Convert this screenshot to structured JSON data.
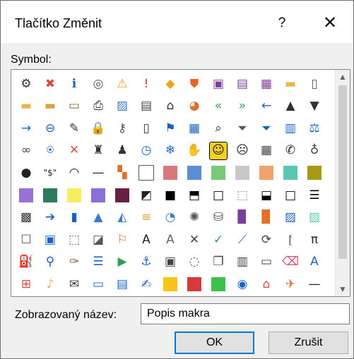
{
  "dialog": {
    "title": "Tlačítko Změnit",
    "help_glyph": "?",
    "close_glyph": "✕",
    "symbol_label": "Symbol:",
    "display_name_label": "Zobrazovaný název:",
    "display_name_value": "Popis makra",
    "ok_label": "OK",
    "cancel_label": "Zrušit",
    "scroll_up_glyph": "▲",
    "scroll_down_glyph": "▼"
  },
  "symbols": [
    {
      "name": "org-chart-icon",
      "glyph": "⚙",
      "color": "#333"
    },
    {
      "name": "error-icon",
      "glyph": "✖",
      "color": "#e04a3c"
    },
    {
      "name": "info-icon",
      "glyph": "ℹ",
      "color": "#1a62c4"
    },
    {
      "name": "record-icon",
      "glyph": "◎",
      "color": "#555"
    },
    {
      "name": "warning-icon",
      "glyph": "⚠",
      "color": "#f0a51c"
    },
    {
      "name": "exclamation-icon",
      "glyph": "!",
      "color": "#e0312c"
    },
    {
      "name": "diamond-warning-icon",
      "glyph": "◆",
      "color": "#f0a51c"
    },
    {
      "name": "shield-icon",
      "glyph": "⛊",
      "color": "#e8641e"
    },
    {
      "name": "save-icon",
      "glyph": "▣",
      "color": "#7a3e9b"
    },
    {
      "name": "save-as-icon",
      "glyph": "▤",
      "color": "#7a3e9b"
    },
    {
      "name": "save-all-icon",
      "glyph": "▦",
      "color": "#7a3e9b"
    },
    {
      "name": "folder-icon",
      "glyph": "▬",
      "color": "#e8b84a"
    },
    {
      "name": "new-document-icon",
      "glyph": "▯",
      "color": "#555"
    },
    {
      "name": "folder-open-icon",
      "glyph": "▬",
      "color": "#e8b84a"
    },
    {
      "name": "folder-up-icon",
      "glyph": "▬",
      "color": "#d9a23a"
    },
    {
      "name": "move-folder-icon",
      "glyph": "▭",
      "color": "#8a6a3a"
    },
    {
      "name": "printer-icon",
      "glyph": "⎙",
      "color": "#333"
    },
    {
      "name": "picture-icon",
      "glyph": "▨",
      "color": "#3a7bc8"
    },
    {
      "name": "document-page-icon",
      "glyph": "▤",
      "color": "#444"
    },
    {
      "name": "home-icon",
      "glyph": "⌂",
      "color": "#333"
    },
    {
      "name": "pie-chart-icon",
      "glyph": "◕",
      "color": "#e0702a"
    },
    {
      "name": "back-double-icon",
      "glyph": "«",
      "color": "#2e9e4f"
    },
    {
      "name": "forward-double-icon",
      "glyph": "»",
      "color": "#2e9e4f"
    },
    {
      "name": "arrow-left-icon",
      "glyph": "←",
      "color": "#1a62c4"
    },
    {
      "name": "triangle-up-icon",
      "glyph": "▲",
      "color": "#333"
    },
    {
      "name": "triangle-down-icon",
      "glyph": "▼",
      "color": "#333"
    },
    {
      "name": "arrow-right-icon",
      "glyph": "→",
      "color": "#1a62c4"
    },
    {
      "name": "circle-back-icon",
      "glyph": "⊖",
      "color": "#1a62c4"
    },
    {
      "name": "pin-icon",
      "glyph": "✎",
      "color": "#333"
    },
    {
      "name": "lock-icon",
      "glyph": "🔒",
      "color": "#e8b84a"
    },
    {
      "name": "key-icon",
      "glyph": "⚷",
      "color": "#555"
    },
    {
      "name": "mobile-icon",
      "glyph": "▯",
      "color": "#333"
    },
    {
      "name": "flag-icon",
      "glyph": "⚑",
      "color": "#1a62c4"
    },
    {
      "name": "calendar-icon",
      "glyph": "▦",
      "color": "#1a62c4"
    },
    {
      "name": "search-icon",
      "glyph": "⌕",
      "color": "#333"
    },
    {
      "name": "filter-icon",
      "glyph": "⏷",
      "color": "#555"
    },
    {
      "name": "filter-clear-icon",
      "glyph": "⏷",
      "color": "#1a62c4"
    },
    {
      "name": "book-icon",
      "glyph": "▥",
      "color": "#1a62c4"
    },
    {
      "name": "scales-icon",
      "glyph": "⚖",
      "color": "#1a62c4"
    },
    {
      "name": "link-icon",
      "glyph": "∞",
      "color": "#444"
    },
    {
      "name": "microphone-icon",
      "glyph": "⍟",
      "color": "#1a62c4"
    },
    {
      "name": "mute-icon",
      "glyph": "✕",
      "color": "#e04a3c"
    },
    {
      "name": "person-suit-icon",
      "glyph": "♜",
      "color": "#333"
    },
    {
      "name": "person-icon",
      "glyph": "♟",
      "color": "#333"
    },
    {
      "name": "clock-icon",
      "glyph": "◷",
      "color": "#1a62c4"
    },
    {
      "name": "snowflake-icon",
      "glyph": "❄",
      "color": "#1a62c4"
    },
    {
      "name": "hand-icon",
      "glyph": "✋",
      "color": "#444"
    },
    {
      "name": "smiley-icon",
      "glyph": "☺",
      "color": "#222"
    },
    {
      "name": "sad-face-icon",
      "glyph": "☹",
      "color": "#222"
    },
    {
      "name": "calculator-icon",
      "glyph": "▦",
      "color": "#444"
    },
    {
      "name": "phone-icon",
      "glyph": "✆",
      "color": "#222"
    },
    {
      "name": "piggy-bank-icon",
      "glyph": "♁",
      "color": "#444"
    },
    {
      "name": "eight-ball-icon",
      "glyph": "●",
      "color": "#222"
    },
    {
      "name": "dollar-icon",
      "glyph": "\"$\"",
      "color": "#222"
    },
    {
      "name": "eye-icon",
      "glyph": "◠",
      "color": "#222"
    },
    {
      "name": "dash-icon",
      "glyph": "—",
      "color": "#222"
    },
    {
      "name": "color-grid-icon",
      "glyph": "▚",
      "color": "#e0702a"
    },
    {
      "name": "white-swatch-icon",
      "swatch": "#ffffff"
    },
    {
      "name": "red-swatch-icon",
      "swatch": "#d9777a"
    },
    {
      "name": "blue-swatch-icon",
      "swatch": "#5a8fd6"
    },
    {
      "name": "green-swatch-icon",
      "swatch": "#7ac97a"
    },
    {
      "name": "gray-swatch-icon",
      "swatch": "#c8c8c8"
    },
    {
      "name": "orange-swatch-icon",
      "swatch": "#f0a36a"
    },
    {
      "name": "teal-swatch-icon",
      "swatch": "#5ac7b0"
    },
    {
      "name": "olive-swatch-icon",
      "swatch": "#a79a14"
    },
    {
      "name": "purple-swatch-icon",
      "swatch": "#9a6fd6"
    },
    {
      "name": "dark-green-swatch-icon",
      "swatch": "#2e7a5c"
    },
    {
      "name": "yellow-swatch-icon",
      "swatch": "#f5ee5f"
    },
    {
      "name": "violet-swatch-icon",
      "swatch": "#8c6fd6"
    },
    {
      "name": "maroon-swatch-icon",
      "swatch": "#6a1f45"
    },
    {
      "name": "half-fill-icon",
      "glyph": "◩",
      "color": "#222"
    },
    {
      "name": "black-fill-icon",
      "glyph": "■",
      "color": "#000"
    },
    {
      "name": "top-fill-icon",
      "glyph": "⬒",
      "color": "#000"
    },
    {
      "name": "border-box-icon",
      "glyph": "□",
      "color": "#000"
    },
    {
      "name": "dotted-box-icon",
      "glyph": "⬚",
      "color": "#888"
    },
    {
      "name": "bottom-fill-icon",
      "glyph": "⬓",
      "color": "#000"
    },
    {
      "name": "empty-box-icon",
      "glyph": "□",
      "color": "#000"
    },
    {
      "name": "striped-box-icon",
      "glyph": "☰",
      "color": "#000"
    },
    {
      "name": "checker-icon",
      "glyph": "▩",
      "color": "#333"
    },
    {
      "name": "circle-arrow-icon",
      "glyph": "➔",
      "color": "#1a62c4"
    },
    {
      "name": "bar-chart-icon",
      "glyph": "▮",
      "color": "#1a62c4"
    },
    {
      "name": "cone-icon",
      "glyph": "▲",
      "color": "#3a7bc8"
    },
    {
      "name": "mountain-chart-icon",
      "glyph": "◭",
      "color": "#3a7bc8"
    },
    {
      "name": "bar-list-icon",
      "glyph": "≡",
      "color": "#e0a030"
    },
    {
      "name": "pie-icon",
      "glyph": "◔",
      "color": "#3a7bc8"
    },
    {
      "name": "spider-chart-icon",
      "glyph": "✺",
      "color": "#555"
    },
    {
      "name": "cylinder-icon",
      "glyph": "⛁",
      "color": "#555"
    },
    {
      "name": "purple-book-icon",
      "glyph": "▉",
      "color": "#7a3e9b"
    },
    {
      "name": "orange-book-icon",
      "glyph": "▉",
      "color": "#e0702a"
    },
    {
      "name": "image-gallery-icon",
      "glyph": "▨",
      "color": "#1a62c4"
    },
    {
      "name": "image-landscape-icon",
      "glyph": "▨",
      "color": "#5ac7b0"
    },
    {
      "name": "frame-icon",
      "glyph": "☐",
      "color": "#555"
    },
    {
      "name": "picture-frame-icon",
      "glyph": "▣",
      "color": "#1a62c4"
    },
    {
      "name": "dotted-frame-icon",
      "glyph": "⬚",
      "color": "#555"
    },
    {
      "name": "slash-box-icon",
      "glyph": "◪",
      "color": "#555"
    },
    {
      "name": "flag-chart-icon",
      "glyph": "⚐",
      "color": "#e0702a"
    },
    {
      "name": "text-box-icon",
      "glyph": "A",
      "color": "#222"
    },
    {
      "name": "text-gray-icon",
      "glyph": "A",
      "color": "#666"
    },
    {
      "name": "cross-icon",
      "glyph": "✕",
      "color": "#444"
    },
    {
      "name": "check-icon",
      "glyph": "✓",
      "color": "#2e9e4f"
    },
    {
      "name": "chart-edit-icon",
      "glyph": "⟋",
      "color": "#1a62c4"
    },
    {
      "name": "refresh-icon",
      "glyph": "⟳",
      "color": "#444"
    },
    {
      "name": "bracket-icon",
      "glyph": "⦍",
      "color": "#444"
    },
    {
      "name": "pi-icon",
      "glyph": "π",
      "color": "#222"
    },
    {
      "name": "paint-bucket-icon",
      "glyph": "⛽",
      "color": "#e8b84a"
    },
    {
      "name": "magnifier-icon",
      "glyph": "⚲",
      "color": "#1a62c4"
    },
    {
      "name": "brush-icon",
      "glyph": "✑",
      "color": "#8a6a3a"
    },
    {
      "name": "bullet-list-icon",
      "glyph": "☰",
      "color": "#1a62c4"
    },
    {
      "name": "play-icon",
      "glyph": "▶",
      "color": "#2e9e4f"
    },
    {
      "name": "anchor-icon",
      "glyph": "⚓",
      "color": "#1a62c4"
    },
    {
      "name": "briefcase-icon",
      "glyph": "▣",
      "color": "#444"
    },
    {
      "name": "shape-add-icon",
      "glyph": "◌",
      "color": "#555"
    },
    {
      "name": "copy-icon",
      "glyph": "❐",
      "color": "#444"
    },
    {
      "name": "clipboard-icon",
      "glyph": "▥",
      "color": "#444"
    },
    {
      "name": "page-icon",
      "glyph": "▭",
      "color": "#444"
    },
    {
      "name": "eraser-icon",
      "glyph": "⌫",
      "color": "#e04a6c"
    },
    {
      "name": "italic-a-icon",
      "glyph": "A",
      "color": "#1a62c4"
    },
    {
      "name": "windows-logo-icon",
      "glyph": "⊞",
      "color": "#e04a3c"
    },
    {
      "name": "bell-icon",
      "glyph": "♪",
      "color": "#e8b84a"
    },
    {
      "name": "envelope-icon",
      "glyph": "✉",
      "color": "#444"
    },
    {
      "name": "card-icon",
      "glyph": "▭",
      "color": "#1a62c4"
    },
    {
      "name": "form-icon",
      "glyph": "▤",
      "color": "#1a62c4"
    },
    {
      "name": "sign-icon",
      "glyph": "✍",
      "color": "#1a62c4"
    },
    {
      "name": "gold-swatch-icon",
      "swatch": "#f5c518"
    },
    {
      "name": "red-hatch-swatch-icon",
      "swatch": "#d9393c"
    },
    {
      "name": "bright-green-swatch-icon",
      "swatch": "#3ac24a"
    },
    {
      "name": "globe-icon",
      "glyph": "◉",
      "color": "#1a62c4"
    },
    {
      "name": "house-globe-icon",
      "glyph": "⌂",
      "color": "#e04a3c"
    },
    {
      "name": "signpost-icon",
      "glyph": "✈",
      "color": "#e0702a"
    },
    {
      "name": "horizontal-line-icon",
      "glyph": "—",
      "color": "#222"
    }
  ]
}
